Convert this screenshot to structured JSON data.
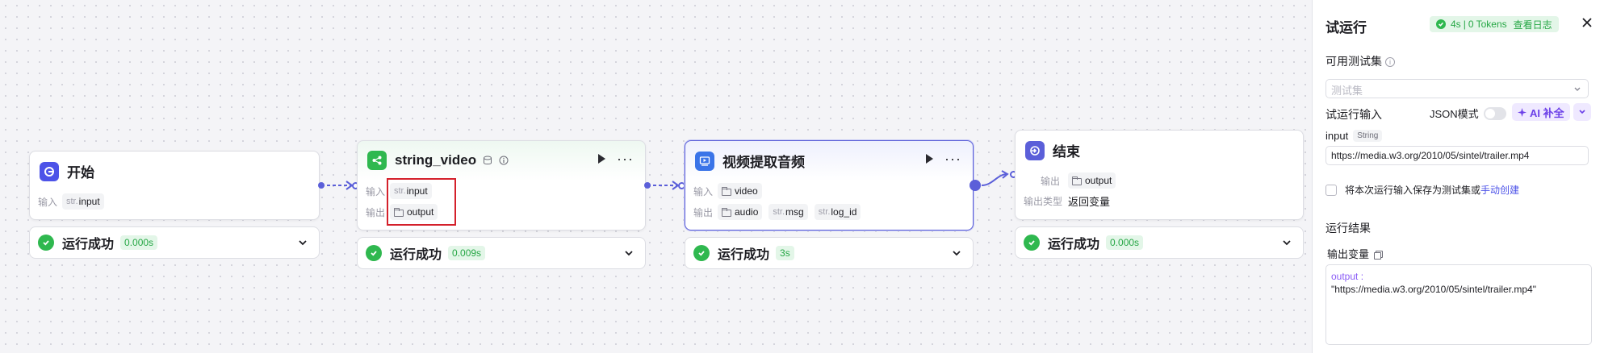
{
  "workflow": {
    "start_node": {
      "title": "开始",
      "input_label": "输入",
      "input_param": {
        "type": "str.",
        "name": "input"
      },
      "status_text": "运行成功",
      "time": "0.000s"
    },
    "string_video_node": {
      "title": "string_video",
      "input_label": "输入",
      "output_label": "输出",
      "input_param": {
        "type": "str.",
        "name": "input"
      },
      "output_param": {
        "name": "output"
      },
      "status_text": "运行成功",
      "time": "0.009s"
    },
    "extract_audio_node": {
      "title": "视频提取音频",
      "input_label": "输入",
      "output_label": "输出",
      "input_param": {
        "name": "video"
      },
      "output_params": [
        {
          "name": "audio"
        },
        {
          "type": "str.",
          "name": "msg"
        },
        {
          "type": "str.",
          "name": "log_id"
        }
      ],
      "status_text": "运行成功",
      "time": "3s"
    },
    "end_node": {
      "title": "结束",
      "output_label": "输出",
      "output_param": {
        "name": "output"
      },
      "output_type_label": "输出类型",
      "output_type_value": "返回变量",
      "status_text": "运行成功",
      "time": "0.000s"
    }
  },
  "panel": {
    "title": "试运行",
    "run_badge": {
      "duration": "4s",
      "tokens": "0 Tokens",
      "log_link": "查看日志"
    },
    "test_set_label": "可用测试集",
    "test_set_placeholder": "测试集",
    "run_input_label": "试运行输入",
    "json_mode_label": "JSON模式",
    "ai_button_label": "AI 补全",
    "input_field_label": "input",
    "input_field_type": "String",
    "input_value": "https://media.w3.org/2010/05/sintel/trailer.mp4",
    "save_text": "将本次运行输入保存为测试集或",
    "create_link": "手动创建",
    "result_label": "运行结果",
    "output_var_label": "输出变量",
    "output_key": "output :",
    "output_value": "\"https://media.w3.org/2010/05/sintel/trailer.mp4\""
  },
  "colors": {
    "accent": "#4d53e8",
    "success": "#2fb84f",
    "highlight": "#d4202b"
  }
}
